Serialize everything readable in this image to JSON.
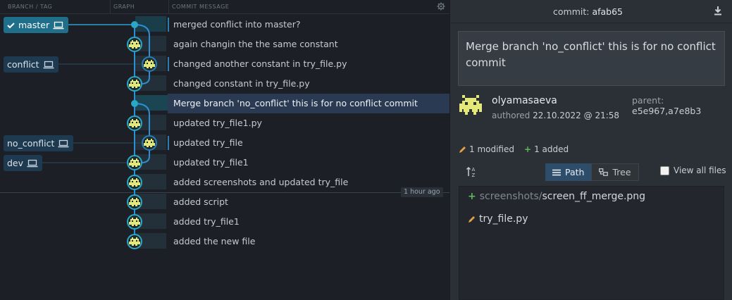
{
  "columns": {
    "branch_tag": "BRANCH / TAG",
    "graph": "GRAPH",
    "commit_message": "COMMIT MESSAGE"
  },
  "branches": {
    "master": "master",
    "conflict": "conflict",
    "no_conflict": "no_conflict",
    "dev": "dev"
  },
  "commits": [
    "merged conflict into master?",
    "again changin the the same constant",
    "changed another constant in try_file.py",
    "changed constant in try_file.py",
    "Merge branch 'no_conflict' this is for no conflict commit",
    "updated try_file1.py",
    "updated try_file",
    "updated try_file1",
    "added screenshots and updated try_file",
    "added script",
    "added try_file1",
    "added the new file"
  ],
  "selected_commit_index": 4,
  "time_marker": "1 hour ago",
  "detail": {
    "commit_label": "commit:",
    "commit_sha": "afab65",
    "message": "Merge branch 'no_conflict' this is for no conflict commit",
    "author": "olyamasaeva",
    "authored_label": "authored",
    "authored_date": "22.10.2022 @ 21:58",
    "parent_label": "parent:",
    "parent_shas": "e5e967,a7e8b3",
    "modified_count": "1 modified",
    "added_count": "1 added",
    "view_path": "Path",
    "view_tree": "Tree",
    "view_all_files": "View all files",
    "files": [
      {
        "status": "added",
        "dir": "screenshots/",
        "name": "screen_ff_merge.png"
      },
      {
        "status": "modified",
        "dir": "",
        "name": "try_file.py"
      }
    ]
  },
  "colors": {
    "accent": "#1f6f8b",
    "graph_line": "#2b8fd6",
    "graph_line_dark": "#1e6f73",
    "selected_row": "#2a3a53",
    "added": "#5fb85a",
    "modified": "#e0a243"
  },
  "icons": [
    "check-icon",
    "laptop-icon",
    "gear-icon",
    "download-icon",
    "sort-az-icon",
    "list-icon",
    "tree-icon",
    "pencil-icon",
    "plus-icon",
    "avatar-icon"
  ]
}
